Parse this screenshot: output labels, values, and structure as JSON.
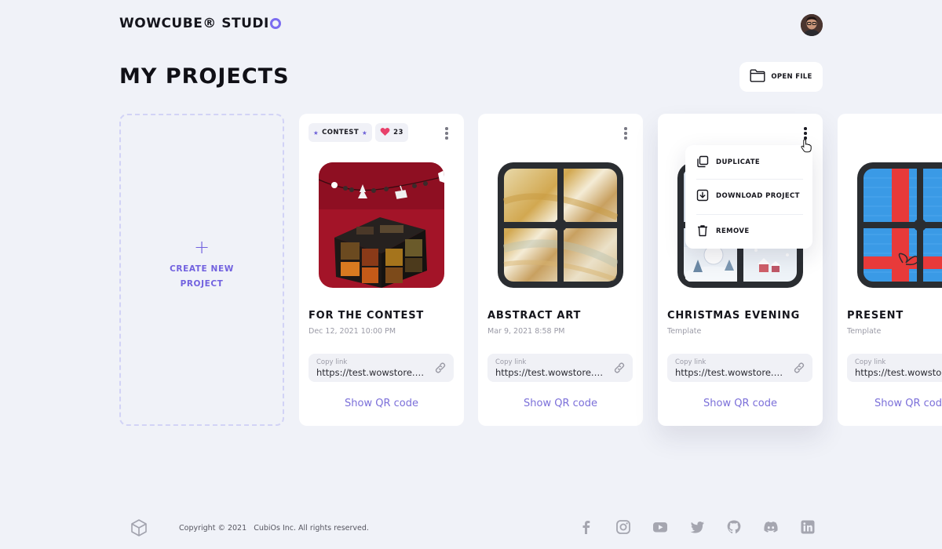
{
  "header": {
    "logo_text": "WOWCUBE® STUDI",
    "logo_accent_color": "#7b6cf0"
  },
  "page_title": "MY PROJECTS",
  "open_file": {
    "label": "OPEN FILE",
    "icon": "folder-icon"
  },
  "new_project": {
    "icon": "plus-icon",
    "label": "CREATE NEW PROJECT"
  },
  "cards": [
    {
      "title": "FOR THE CONTEST",
      "subtitle": "Dec 12, 2021 10:00 PM",
      "tags": {
        "contest_label": "CONTEST",
        "likes": "23"
      },
      "link_caption": "Copy link",
      "link_url": "https://test.wowstore.wo...",
      "qr_label": "Show QR code",
      "thumbnail": "christmas-cube-photo"
    },
    {
      "title": "ABSTRACT ART",
      "subtitle": "Mar 9, 2021 8:58 PM",
      "link_caption": "Copy link",
      "link_url": "https://test.wowstore.wo...",
      "qr_label": "Show QR code",
      "thumbnail": "gold-marble-cube-face"
    },
    {
      "title": "CHRISTMAS EVENING",
      "subtitle": "Template",
      "link_caption": "Copy link",
      "link_url": "https://test.wowstore.wo...",
      "qr_label": "Show QR code",
      "thumbnail": "winter-village-cube-face"
    },
    {
      "title": "PRESENT",
      "subtitle": "Template",
      "link_caption": "Copy link",
      "link_url": "https://test.wowstore.wo...",
      "qr_label": "Show QR code",
      "thumbnail": "gift-box-cube-face"
    }
  ],
  "context_menu": {
    "items": [
      {
        "label": "DUPLICATE",
        "icon": "duplicate-icon"
      },
      {
        "label": "DOWNLOAD PROJECT",
        "icon": "download-icon"
      },
      {
        "label": "REMOVE",
        "icon": "trash-icon"
      }
    ]
  },
  "footer": {
    "copyright": "Copyright © 2021",
    "company": "CubiOs Inc. All rights reserved.",
    "socials": [
      "facebook-icon",
      "instagram-icon",
      "youtube-icon",
      "twitter-icon",
      "github-icon",
      "discord-icon",
      "linkedin-icon"
    ]
  },
  "colors": {
    "accent": "#7262df",
    "background": "#f0f2f8",
    "like": "#e8406a"
  }
}
